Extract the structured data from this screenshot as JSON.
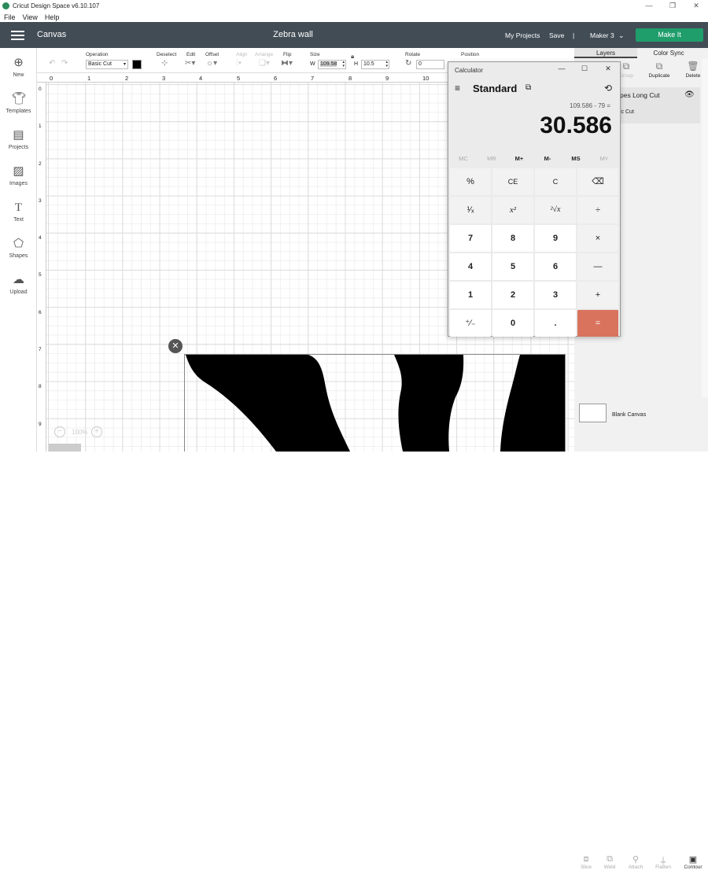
{
  "window": {
    "title": "Cricut Design Space",
    "version": "v6.10.107",
    "controls": [
      "—",
      "❐",
      "✕"
    ]
  },
  "menubar": [
    "File",
    "View",
    "Help"
  ],
  "header": {
    "section": "Canvas",
    "project_name": "Zebra wall",
    "my_projects": "My Projects",
    "save": "Save",
    "separator": "|",
    "machine": "Maker 3",
    "make_it": "Make It"
  },
  "toolbar": {
    "operation_label": "Operation",
    "operation_value": "Basic Cut",
    "deselect_label": "Deselect",
    "edit_label": "Edit",
    "offset_label": "Offset",
    "align_label": "Align",
    "arrange_label": "Arrange",
    "flip_label": "Flip",
    "size_label": "Size",
    "w_label": "W",
    "w_value": "109.58",
    "h_label": "H",
    "h_value": "10.5",
    "rotate_label": "Rotate",
    "rotate_value": "0",
    "position_label": "Position"
  },
  "sidebar": {
    "items": [
      {
        "label": "New",
        "icon": "plus-circle-icon"
      },
      {
        "label": "Templates",
        "icon": "shirt-icon"
      },
      {
        "label": "Projects",
        "icon": "projects-icon"
      },
      {
        "label": "Images",
        "icon": "image-icon"
      },
      {
        "label": "Text",
        "icon": "text-icon"
      },
      {
        "label": "Shapes",
        "icon": "shapes-icon"
      },
      {
        "label": "Upload",
        "icon": "upload-icon"
      }
    ]
  },
  "ruler": {
    "top": [
      "0",
      "1",
      "2",
      "3",
      "4",
      "5",
      "6",
      "7",
      "8",
      "9",
      "10"
    ],
    "left": [
      "0",
      "1",
      "2",
      "3",
      "4",
      "5",
      "6",
      "7",
      "8",
      "9"
    ]
  },
  "zoom": {
    "value": "100%",
    "minus": "−",
    "plus": "+"
  },
  "right_panel": {
    "tabs": [
      "Layers",
      "Color Sync"
    ],
    "actions": [
      "Group",
      "Duplicate",
      "Delete"
    ],
    "layer_name": "pes Long Cut",
    "layer_sub": "ic Cut",
    "blank_canvas": "Blank Canvas",
    "bottom_actions": [
      "Slice",
      "Weld",
      "Attach",
      "Flatten",
      "Contour"
    ]
  },
  "calculator": {
    "title": "Calculator",
    "mode": "Standard",
    "expression": "109.586 - 79 =",
    "display": "30.586",
    "memory": [
      "MC",
      "MR",
      "M+",
      "M-",
      "MS",
      "M˅"
    ],
    "keys": [
      [
        "%",
        "CE",
        "C",
        "⌫"
      ],
      [
        "¹⁄ₓ",
        "x²",
        "²√x",
        "÷"
      ],
      [
        "7",
        "8",
        "9",
        "×"
      ],
      [
        "4",
        "5",
        "6",
        "—"
      ],
      [
        "1",
        "2",
        "3",
        "+"
      ],
      [
        "⁺⁄₋",
        "0",
        ".",
        "="
      ]
    ]
  },
  "colors": {
    "header_bg": "#414c55",
    "make_it": "#1f9d6b",
    "equals_key": "#d9735e"
  }
}
